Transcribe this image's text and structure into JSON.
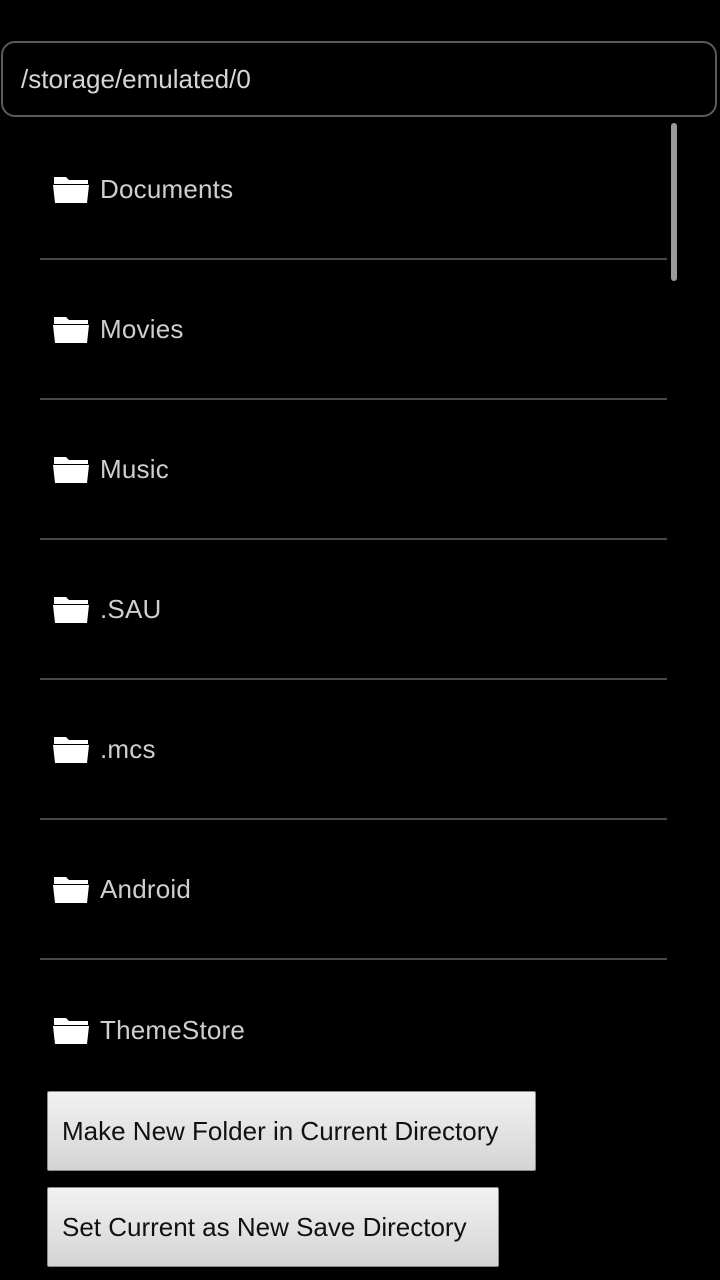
{
  "path_bar": {
    "current_path": "/storage/emulated/0"
  },
  "folders": [
    {
      "label": "Documents",
      "icon": "folder-icon"
    },
    {
      "label": "Movies",
      "icon": "folder-icon"
    },
    {
      "label": "Music",
      "icon": "folder-icon"
    },
    {
      "label": ".SAU",
      "icon": "folder-icon"
    },
    {
      "label": ".mcs",
      "icon": "folder-icon"
    },
    {
      "label": "Android",
      "icon": "folder-icon"
    },
    {
      "label": "ThemeStore",
      "icon": "folder-icon"
    }
  ],
  "buttons": {
    "make_folder": "Make New Folder in Current Directory",
    "set_save_dir": "Set Current as New Save Directory"
  },
  "colors": {
    "background": "#000000",
    "text": "#cfcfcf",
    "divider": "#4a4a4a",
    "button_bg": "#e0e0e0",
    "folder_icon": "#ffffff"
  }
}
